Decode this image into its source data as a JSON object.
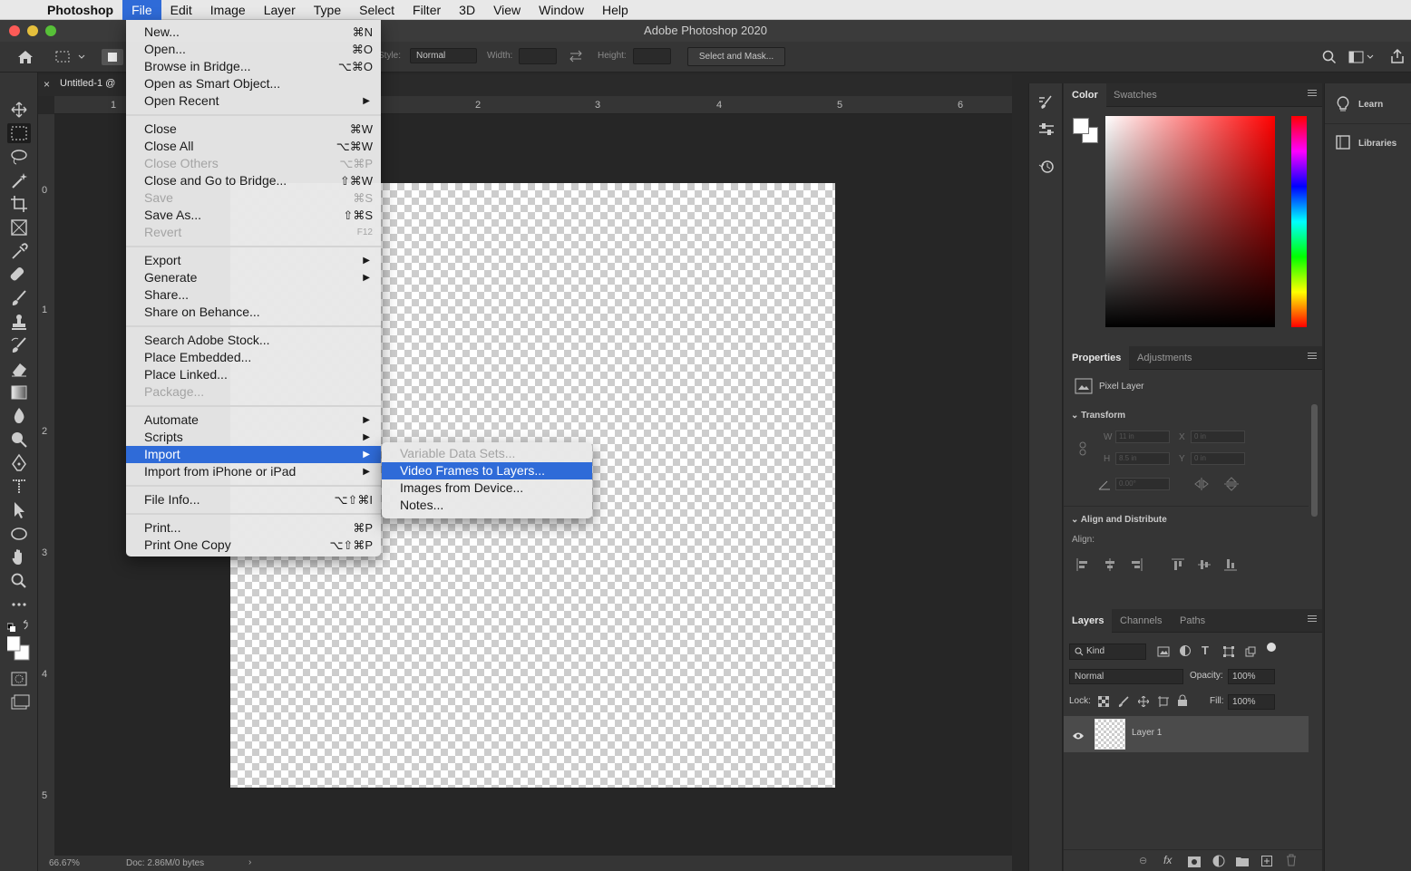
{
  "mac_menubar": {
    "app": "Photoshop",
    "menus": [
      "File",
      "Edit",
      "Image",
      "Layer",
      "Type",
      "Select",
      "Filter",
      "3D",
      "View",
      "Window",
      "Help"
    ]
  },
  "window": {
    "title": "Adobe Photoshop 2020"
  },
  "options_bar": {
    "style_label": "Style:",
    "style_value": "Normal",
    "width_label": "Width:",
    "height_label": "Height:",
    "select_mask": "Select and Mask..."
  },
  "document": {
    "tab": "Untitled-1 @",
    "ruler_h": [
      "1",
      "2",
      "3",
      "4",
      "5",
      "6"
    ],
    "ruler_v": [
      "0",
      "1",
      "2",
      "3",
      "4",
      "5"
    ],
    "zoom": "66.67%",
    "doc_info": "Doc: 2.86M/0 bytes"
  },
  "file_menu": {
    "items": [
      {
        "label": "New...",
        "shortcut": "⌘N"
      },
      {
        "label": "Open...",
        "shortcut": "⌘O"
      },
      {
        "label": "Browse in Bridge...",
        "shortcut": "⌥⌘O"
      },
      {
        "label": "Open as Smart Object...",
        "shortcut": ""
      },
      {
        "label": "Open Recent",
        "shortcut": ""
      },
      {
        "label": "Close",
        "shortcut": "⌘W"
      },
      {
        "label": "Close All",
        "shortcut": "⌥⌘W"
      },
      {
        "label": "Close Others",
        "shortcut": "⌥⌘P"
      },
      {
        "label": "Close and Go to Bridge...",
        "shortcut": "⇧⌘W"
      },
      {
        "label": "Save",
        "shortcut": "⌘S"
      },
      {
        "label": "Save As...",
        "shortcut": "⇧⌘S"
      },
      {
        "label": "Revert",
        "shortcut": "F12"
      },
      {
        "label": "Export",
        "shortcut": ""
      },
      {
        "label": "Generate",
        "shortcut": ""
      },
      {
        "label": "Share...",
        "shortcut": ""
      },
      {
        "label": "Share on Behance...",
        "shortcut": ""
      },
      {
        "label": "Search Adobe Stock...",
        "shortcut": ""
      },
      {
        "label": "Place Embedded...",
        "shortcut": ""
      },
      {
        "label": "Place Linked...",
        "shortcut": ""
      },
      {
        "label": "Package...",
        "shortcut": ""
      },
      {
        "label": "Automate",
        "shortcut": ""
      },
      {
        "label": "Scripts",
        "shortcut": ""
      },
      {
        "label": "Import",
        "shortcut": ""
      },
      {
        "label": "Import from iPhone or iPad",
        "shortcut": ""
      },
      {
        "label": "File Info...",
        "shortcut": "⌥⇧⌘I"
      },
      {
        "label": "Print...",
        "shortcut": "⌘P"
      },
      {
        "label": "Print One Copy",
        "shortcut": "⌥⇧⌘P"
      }
    ]
  },
  "import_submenu": {
    "items": [
      "Variable Data Sets...",
      "Video Frames to Layers...",
      "Images from Device...",
      "Notes..."
    ]
  },
  "color_panel": {
    "tabs": [
      "Color",
      "Swatches"
    ]
  },
  "properties_panel": {
    "tabs": [
      "Properties",
      "Adjustments"
    ],
    "layer_type": "Pixel Layer",
    "transform": "Transform",
    "w_label": "W",
    "w_value": "11 in",
    "h_label": "H",
    "h_value": "8.5 in",
    "x_label": "X",
    "x_value": "0 in",
    "y_label": "Y",
    "y_value": "0 in",
    "angle_value": "0.00°",
    "align_section": "Align and Distribute",
    "align_label": "Align:"
  },
  "layers_panel": {
    "tabs": [
      "Layers",
      "Channels",
      "Paths"
    ],
    "kind": "Kind",
    "blend_mode": "Normal",
    "opacity_label": "Opacity:",
    "opacity_value": "100%",
    "lock_label": "Lock:",
    "fill_label": "Fill:",
    "fill_value": "100%",
    "layer_name": "Layer 1"
  },
  "learn_panel": {
    "learn": "Learn",
    "libraries": "Libraries"
  },
  "colors": {
    "menu_highlight": "#2f6bd8",
    "panel_bg": "#353535"
  }
}
